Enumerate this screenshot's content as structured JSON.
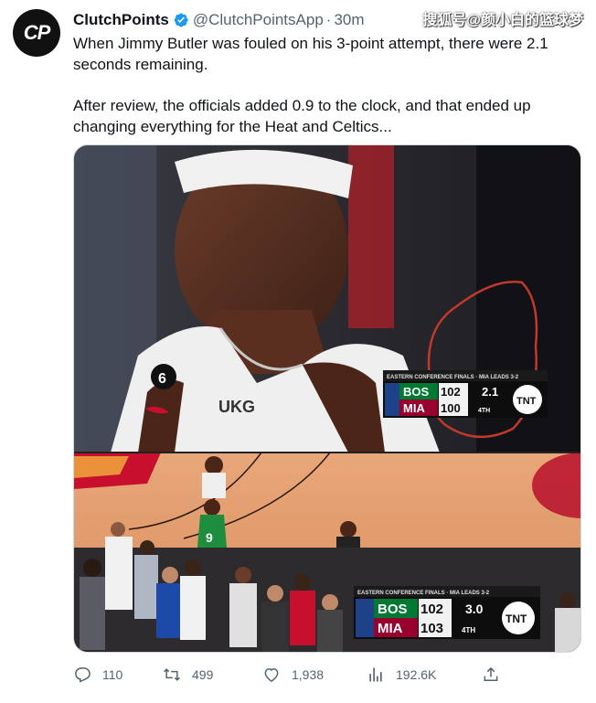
{
  "author": {
    "display_name": "ClutchPoints",
    "handle": "@ClutchPointsApp",
    "separator": "·",
    "time": "30m",
    "avatar_text": "CP"
  },
  "watermark": "搜狐号@颜小白的篮球梦",
  "tweet": {
    "paragraph1": "When Jimmy Butler was fouled on his 3-point attempt, there were 2.1 seconds remaining.",
    "paragraph2": "After review, the officials added 0.9 to the clock, and that ended up changing everything for the Heat and Celtics..."
  },
  "media": {
    "top_frame": {
      "banner": "EASTERN CONFERENCE FINALS · MIA LEADS 3-2",
      "team1": "BOS",
      "score1": "102",
      "team2": "MIA",
      "score2": "100",
      "clock": "2.1",
      "quarter": "4TH",
      "network": "TNT",
      "jersey_text": "UKG",
      "patch": "6"
    },
    "bottom_frame": {
      "banner": "EASTERN CONFERENCE FINALS · MIA LEADS 3-2",
      "team1": "BOS",
      "score1": "102",
      "team2": "MIA",
      "score2": "103",
      "clock": "3.0",
      "quarter": "4TH",
      "network": "TNT",
      "player_number": "9"
    }
  },
  "actions": {
    "replies": "110",
    "retweets": "499",
    "likes": "1,938",
    "views": "192.6K"
  },
  "colors": {
    "verified": "#1d9bf0",
    "muted": "#536471",
    "text": "#0f1419",
    "celtics_green": "#007a33",
    "heat_red": "#98002e"
  }
}
